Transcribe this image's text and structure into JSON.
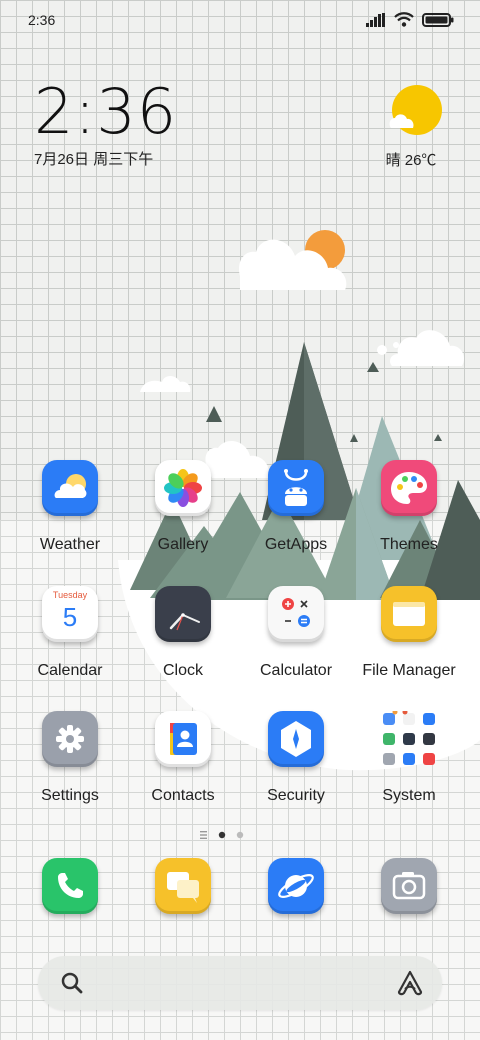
{
  "status_bar": {
    "time": "2:36",
    "icons": [
      "signal-icon",
      "wifi-icon",
      "battery-icon"
    ]
  },
  "clock_widget": {
    "time": "2:36",
    "date": "7月26日 周三下午"
  },
  "weather_widget": {
    "icon": "sunny-cloud-icon",
    "text": "晴 26℃"
  },
  "apps": [
    {
      "label": "Weather",
      "icon": "weather-icon"
    },
    {
      "label": "Gallery",
      "icon": "gallery-icon"
    },
    {
      "label": "GetApps",
      "icon": "getapps-icon"
    },
    {
      "label": "Themes",
      "icon": "themes-icon"
    },
    {
      "label": "Calendar",
      "icon": "calendar-icon",
      "day_name": "Tuesday",
      "day": "5"
    },
    {
      "label": "Clock",
      "icon": "clock-icon"
    },
    {
      "label": "Calculator",
      "icon": "calculator-icon"
    },
    {
      "label": "File Manager",
      "icon": "file-manager-icon"
    },
    {
      "label": "Settings",
      "icon": "settings-icon"
    },
    {
      "label": "Contacts",
      "icon": "contacts-icon"
    },
    {
      "label": "Security",
      "icon": "security-icon"
    },
    {
      "label": "System",
      "icon": "system-folder-icon"
    }
  ],
  "page_indicator": {
    "pages": 2,
    "current": 1
  },
  "dock": [
    {
      "name": "phone",
      "icon": "phone-icon"
    },
    {
      "name": "messages",
      "icon": "messages-icon"
    },
    {
      "name": "browser",
      "icon": "browser-icon"
    },
    {
      "name": "camera",
      "icon": "camera-icon"
    }
  ],
  "search_bar": {
    "left_icon": "search-icon",
    "right_icon": "assistant-icon"
  },
  "colors": {
    "background": "#f0f1ef",
    "sun": "#f7c600",
    "orange_sun": "#f39c3c",
    "tree_dark": "#4e5d57",
    "tree_mid": "#7a9688",
    "tree_light": "#9cb8b4"
  }
}
